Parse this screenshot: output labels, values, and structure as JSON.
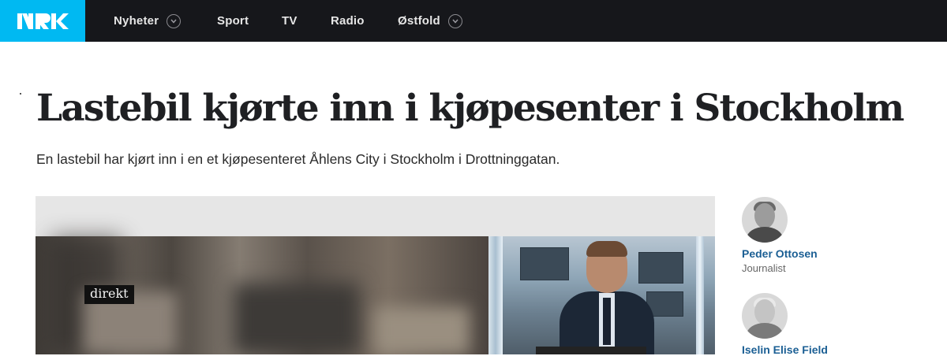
{
  "header": {
    "logo_text": "NRK",
    "nav": [
      {
        "label": "Nyheter",
        "has_dropdown": true
      },
      {
        "label": "Sport",
        "has_dropdown": false
      },
      {
        "label": "TV",
        "has_dropdown": false
      },
      {
        "label": "Radio",
        "has_dropdown": false
      },
      {
        "label": "Østfold",
        "has_dropdown": true
      }
    ]
  },
  "article": {
    "title": "Lastebil kjørte inn i kjøpesenter i Stockholm",
    "lead": "En lastebil har kjørt inn i en et kjøpesenteret Åhlens City i Stockholm i Drottninggatan."
  },
  "video": {
    "live_label": "direkt"
  },
  "authors": [
    {
      "name": "Peder Ottosen",
      "role": "Journalist"
    },
    {
      "name": "Iselin Elise Field",
      "role": ""
    }
  ],
  "colors": {
    "topbar": "#16171b",
    "logo_bg": "#00b9f2",
    "author_link": "#1b5f94"
  }
}
